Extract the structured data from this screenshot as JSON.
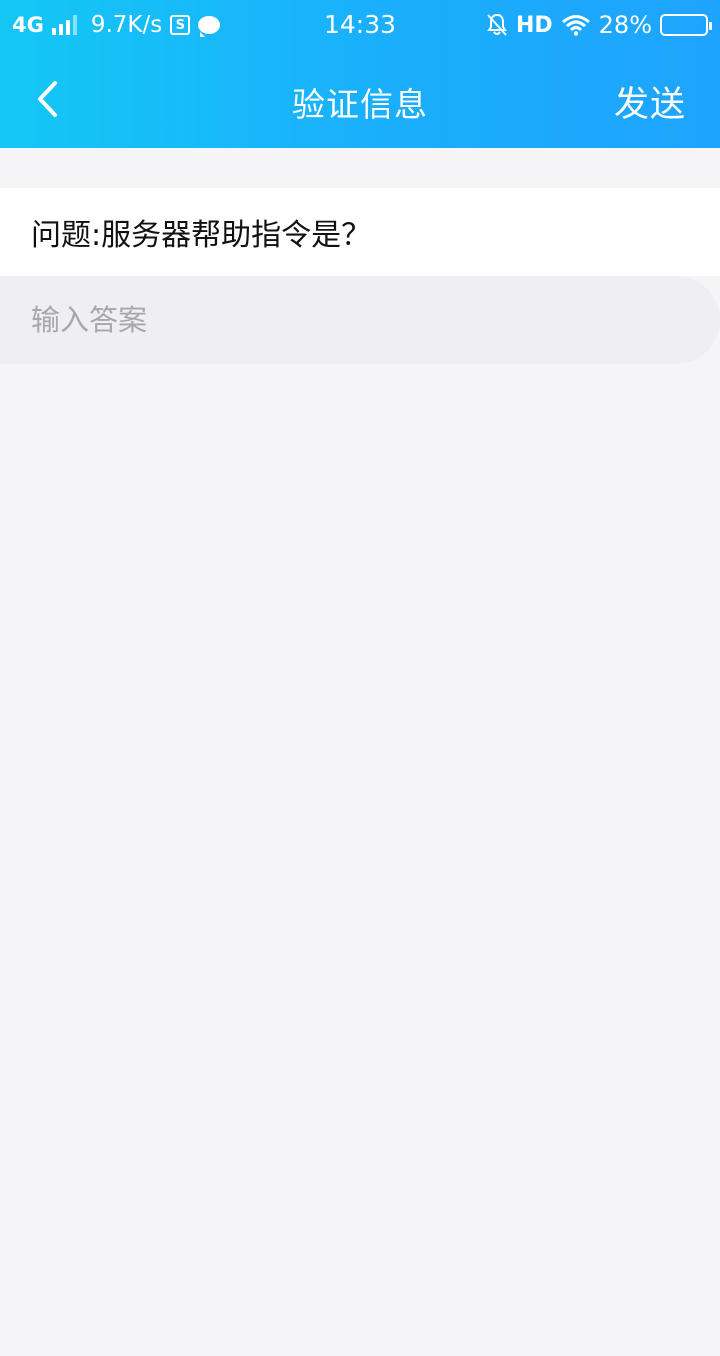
{
  "status_bar": {
    "network": "4G",
    "speed": "9.7K/s",
    "box_glyph": "S",
    "time": "14:33",
    "hd": "HD",
    "battery": "28%",
    "battery_level": 0.28,
    "icons": [
      "signal-icon",
      "screenshot-icon",
      "chat-bubble-icon",
      "bell-off-icon",
      "wifi-icon",
      "battery-icon"
    ]
  },
  "navbar": {
    "back_icon": "chevron-left-icon",
    "title": "验证信息",
    "send_label": "发送"
  },
  "form": {
    "question": "问题:服务器帮助指令是？",
    "answer_value": "",
    "answer_placeholder": "输入答案"
  },
  "colors": {
    "header_start": "#14c7f5",
    "header_end": "#1ea4fd",
    "background": "#f5f5f8",
    "input_background": "#eeeef3"
  }
}
